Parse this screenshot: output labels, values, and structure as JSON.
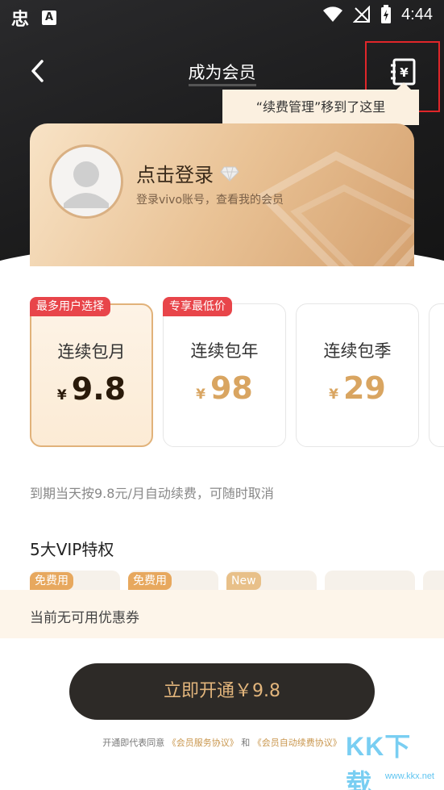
{
  "status_bar": {
    "time": "4:44",
    "app1": "忠",
    "app2": "A"
  },
  "nav": {
    "title": "成为会员"
  },
  "tooltip": {
    "text": "“续费管理”移到了这里"
  },
  "member_card": {
    "title": "点击登录",
    "subtitle": "登录vivo账号，查看我的会员"
  },
  "plans": [
    {
      "tag": "最多用户选择",
      "name": "连续包月",
      "currency": "¥",
      "price": "9.8",
      "selected": true
    },
    {
      "tag": "专享最低价",
      "name": "连续包年",
      "currency": "¥",
      "price": "98",
      "selected": false
    },
    {
      "tag": "",
      "name": "连续包季",
      "currency": "¥",
      "price": "29",
      "selected": false
    }
  ],
  "renew_note": "到期当天按9.8元/月自动续费，可随时取消",
  "vip_section": {
    "title": "5大VIP特权"
  },
  "privileges": [
    {
      "tag": "免费用"
    },
    {
      "tag": "免费用"
    },
    {
      "tag": "New"
    },
    {
      "tag": ""
    },
    {
      "tag": ""
    }
  ],
  "coupon": {
    "text": "当前无可用优惠券"
  },
  "cta": {
    "label": "立即开通￥9.8"
  },
  "agreement": {
    "prefix": "开通即代表同意",
    "link1": "《会员服务协议》",
    "middle": "和",
    "link2": "《会员自动续费协议》"
  },
  "watermark": {
    "text": "KK下载",
    "url": "www.kkx.net"
  },
  "colors": {
    "accent_gold": "#e2b57c",
    "tag_red": "#e8454a",
    "dark_button": "#2d2a27",
    "highlight_red": "#e0262a"
  }
}
